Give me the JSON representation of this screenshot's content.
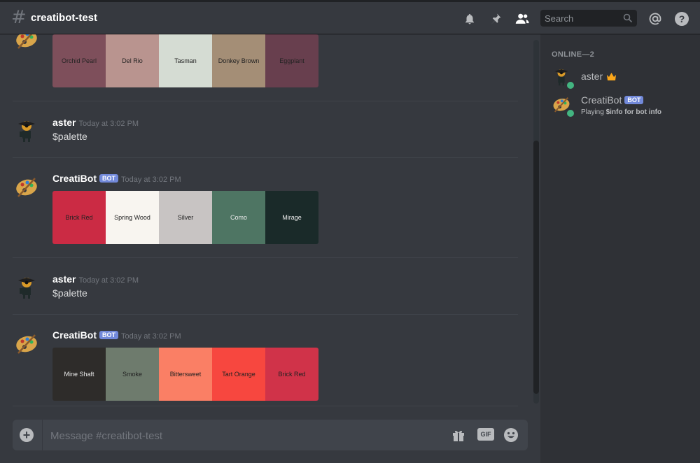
{
  "channel": {
    "name": "creatibot-test",
    "hash_icon": "hashtag-icon"
  },
  "header_icons": [
    "bell-icon",
    "pin-icon",
    "members-icon",
    "mention-icon",
    "help-icon"
  ],
  "search": {
    "placeholder": "Search"
  },
  "messages": [
    {
      "palette": [
        {
          "name": "Orchid Pearl",
          "color": "#7e4f5b",
          "text_color": "#222222"
        },
        {
          "name": "Del Rio",
          "color": "#b9948f",
          "text_color": "#222222"
        },
        {
          "name": "Tasman",
          "color": "#d5dcd3",
          "text_color": "#222222"
        },
        {
          "name": "Donkey Brown",
          "color": "#a48e76",
          "text_color": "#222222"
        },
        {
          "name": "Eggplant",
          "color": "#683f4e",
          "text_color": "#222222"
        }
      ]
    },
    {
      "author": "aster",
      "timestamp": "Today at 3:02 PM",
      "text": "$palette"
    },
    {
      "author": "CreatiBot",
      "badge": "BOT",
      "timestamp": "Today at 3:02 PM",
      "palette": [
        {
          "name": "Brick Red",
          "color": "#cb2b44",
          "text_color": "#222222"
        },
        {
          "name": "Spring Wood",
          "color": "#f8f5f0",
          "text_color": "#222222"
        },
        {
          "name": "Silver",
          "color": "#c8c4c3",
          "text_color": "#222222"
        },
        {
          "name": "Como",
          "color": "#4e7563",
          "text_color": "#e8e8e8"
        },
        {
          "name": "Mirage",
          "color": "#1a2a29",
          "text_color": "#e8e8e8"
        }
      ]
    },
    {
      "author": "aster",
      "timestamp": "Today at 3:02 PM",
      "text": "$palette"
    },
    {
      "author": "CreatiBot",
      "badge": "BOT",
      "timestamp": "Today at 3:02 PM",
      "palette": [
        {
          "name": "Mine Shaft",
          "color": "#2e2c2a",
          "text_color": "#e8e8e8"
        },
        {
          "name": "Smoke",
          "color": "#6e7b6d",
          "text_color": "#222222"
        },
        {
          "name": "Bittersweet",
          "color": "#fa7f65",
          "text_color": "#222222"
        },
        {
          "name": "Tart Orange",
          "color": "#f7473f",
          "text_color": "#222222"
        },
        {
          "name": "Brick Red",
          "color": "#d03349",
          "text_color": "#222222"
        }
      ]
    }
  ],
  "composer": {
    "placeholder": "Message #creatibot-test",
    "gif_label": "GIF"
  },
  "members": {
    "header": "ONLINE—2",
    "list": [
      {
        "name": "aster",
        "crown_icon": "crown-icon",
        "status": "online"
      },
      {
        "name": "CreatiBot",
        "badge": "BOT",
        "activity_prefix": "Playing",
        "activity": "$info for bot info",
        "status": "online"
      }
    ]
  },
  "colors": {
    "accent": "#7289da",
    "online": "#43b581",
    "background": "#36393f",
    "sidebar": "#2f3136"
  }
}
